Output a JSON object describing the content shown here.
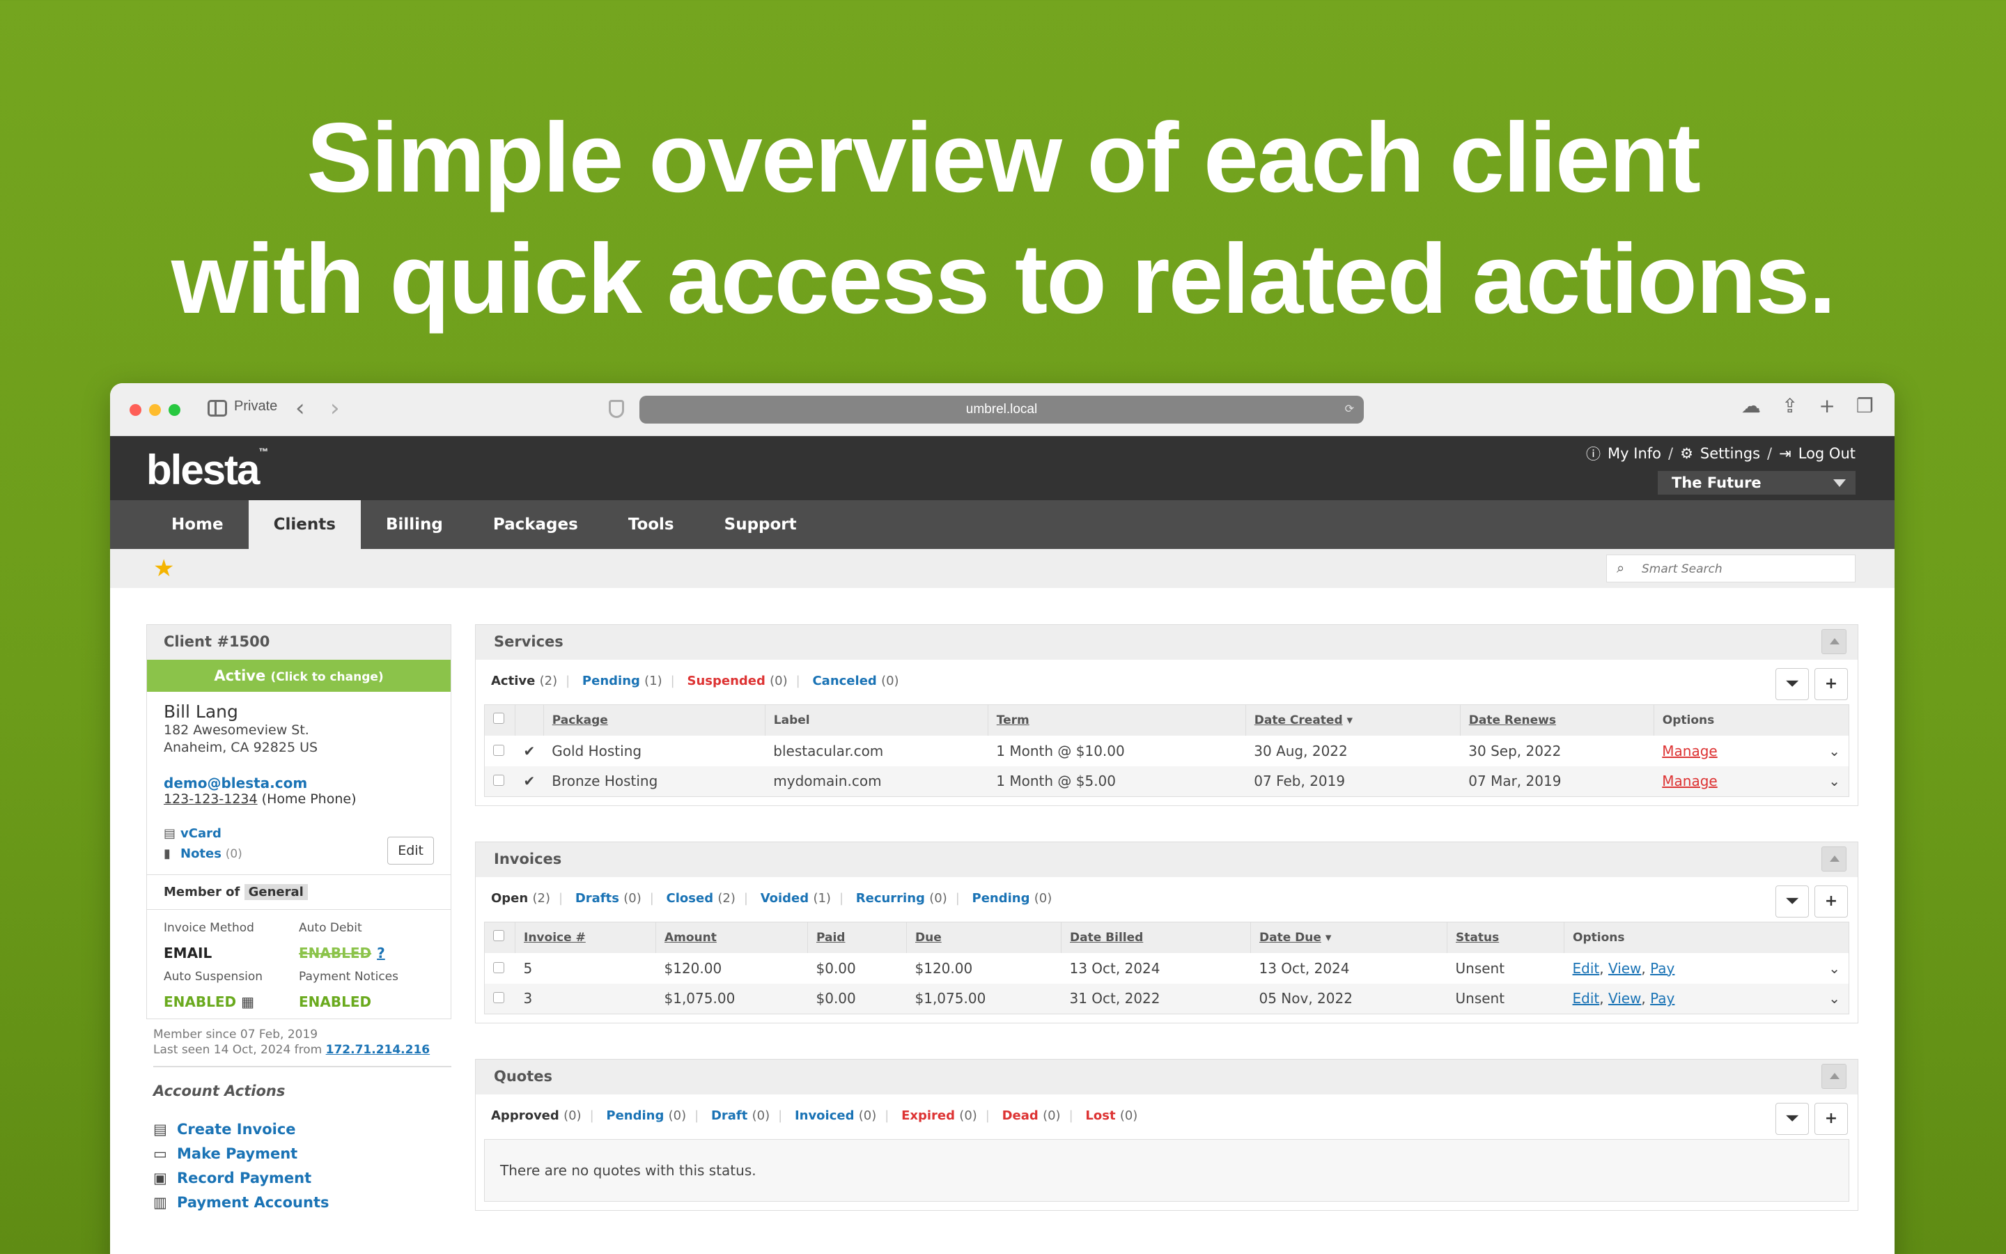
{
  "headline": {
    "line1": "Simple overview of each client",
    "line2": "with quick access to related actions."
  },
  "browser": {
    "private_label": "Private",
    "url": "umbrel.local"
  },
  "app": {
    "logo": "blesta",
    "logo_tm": "™",
    "topnav": {
      "my_info": "My Info",
      "settings": "Settings",
      "log_out": "Log Out",
      "sep": "/"
    },
    "company": "The Future",
    "tabs": [
      "Home",
      "Clients",
      "Billing",
      "Packages",
      "Tools",
      "Support"
    ],
    "active_tab": "Clients",
    "search_placeholder": "Smart Search"
  },
  "client": {
    "header": "Client #1500",
    "status": "Active",
    "status_hint": "(Click to change)",
    "name": "Bill Lang",
    "address1": "182 Awesomeview St.",
    "address2": "Anaheim, CA 92825 US",
    "email": "demo@blesta.com",
    "phone": "123-123-1234",
    "phone_type": "(Home Phone)",
    "vcard": "vCard",
    "notes": "Notes",
    "notes_count": "(0)",
    "edit": "Edit",
    "member_of_label": "Member of",
    "group": "General",
    "invoice_method_label": "Invoice Method",
    "invoice_method": "EMAIL",
    "auto_debit_label": "Auto Debit",
    "auto_debit": "ENABLED",
    "auto_debit_help": "?",
    "auto_suspension_label": "Auto Suspension",
    "auto_suspension": "ENABLED",
    "payment_notices_label": "Payment Notices",
    "payment_notices": "ENABLED",
    "member_since": "Member since 07 Feb, 2019",
    "last_seen": "Last seen 14 Oct, 2024 from",
    "last_ip": "172.71.214.216",
    "account_actions_title": "Account Actions",
    "actions": [
      "Create Invoice",
      "Make Payment",
      "Record Payment",
      "Payment Accounts"
    ]
  },
  "services": {
    "title": "Services",
    "filters": [
      {
        "label": "Active",
        "count": "(2)",
        "style": "cur"
      },
      {
        "label": "Pending",
        "count": "(1)",
        "style": "link"
      },
      {
        "label": "Suspended",
        "count": "(0)",
        "style": "red"
      },
      {
        "label": "Canceled",
        "count": "(0)",
        "style": "link"
      }
    ],
    "columns": [
      "Package",
      "Label",
      "Term",
      "Date Created",
      "Date Renews",
      "Options"
    ],
    "rows": [
      {
        "package": "Gold Hosting",
        "label": "blestacular.com",
        "term": "1 Month @ $10.00",
        "created": "30 Aug, 2022",
        "renews": "30 Sep, 2022",
        "option": "Manage"
      },
      {
        "package": "Bronze Hosting",
        "label": "mydomain.com",
        "term": "1 Month @ $5.00",
        "created": "07 Feb, 2019",
        "renews": "07 Mar, 2019",
        "option": "Manage"
      }
    ]
  },
  "invoices": {
    "title": "Invoices",
    "filters": [
      {
        "label": "Open",
        "count": "(2)",
        "style": "cur"
      },
      {
        "label": "Drafts",
        "count": "(0)",
        "style": "link"
      },
      {
        "label": "Closed",
        "count": "(2)",
        "style": "link"
      },
      {
        "label": "Voided",
        "count": "(1)",
        "style": "link"
      },
      {
        "label": "Recurring",
        "count": "(0)",
        "style": "link"
      },
      {
        "label": "Pending",
        "count": "(0)",
        "style": "link"
      }
    ],
    "columns": [
      "Invoice #",
      "Amount",
      "Paid",
      "Due",
      "Date Billed",
      "Date Due",
      "Status",
      "Options"
    ],
    "rows": [
      {
        "num": "5",
        "amount": "$120.00",
        "paid": "$0.00",
        "due": "$120.00",
        "billed": "13 Oct, 2024",
        "date_due": "13 Oct, 2024",
        "overdue": true,
        "status": "Unsent"
      },
      {
        "num": "3",
        "amount": "$1,075.00",
        "paid": "$0.00",
        "due": "$1,075.00",
        "billed": "31 Oct, 2022",
        "date_due": "05 Nov, 2022",
        "overdue": false,
        "status": "Unsent"
      }
    ],
    "opt_edit": "Edit",
    "opt_view": "View",
    "opt_pay": "Pay"
  },
  "quotes": {
    "title": "Quotes",
    "filters": [
      {
        "label": "Approved",
        "count": "(0)",
        "style": "cur"
      },
      {
        "label": "Pending",
        "count": "(0)",
        "style": "link"
      },
      {
        "label": "Draft",
        "count": "(0)",
        "style": "link"
      },
      {
        "label": "Invoiced",
        "count": "(0)",
        "style": "link"
      },
      {
        "label": "Expired",
        "count": "(0)",
        "style": "red"
      },
      {
        "label": "Dead",
        "count": "(0)",
        "style": "red"
      },
      {
        "label": "Lost",
        "count": "(0)",
        "style": "red"
      }
    ],
    "empty": "There are no quotes with this status."
  },
  "colors": {
    "background": "#6fa01c",
    "accent": "#1a73b5",
    "active_status": "#8bc34a",
    "danger": "#dd3333"
  }
}
